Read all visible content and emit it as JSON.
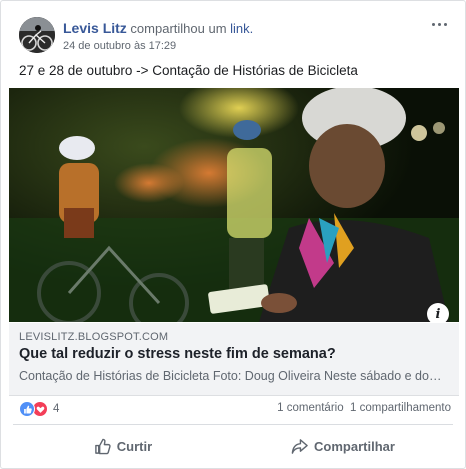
{
  "post": {
    "author": "Levis Litz",
    "shared_text": "compartilhou um",
    "shared_link": "link.",
    "timestamp": "24 de outubro às 17:29",
    "text": "27 e 28 de outubro -> Contação de Histórias de Bicicleta"
  },
  "link_preview": {
    "domain": "LEVISLITZ.BLOGSPOT.COM",
    "title": "Que tal reduzir o stress neste fim de semana?",
    "description": "Contação de Histórias de Bicicleta Foto: Doug Oliveira Neste sábado e domingo..."
  },
  "stats": {
    "reaction_count": "4",
    "comments": "1 comentário",
    "shares": "1 compartilhamento"
  },
  "actions": {
    "like": "Curtir",
    "share": "Compartilhar"
  },
  "icons": {
    "more": "more-options-icon",
    "info": "info-icon",
    "like_reaction": "like-reaction-icon",
    "love_reaction": "love-reaction-icon",
    "like_action": "thumbs-up-icon",
    "share_action": "share-arrow-icon"
  },
  "colors": {
    "link_blue": "#385898",
    "secondary_text": "#606770",
    "like_blue": "#4f8ff7",
    "love_red": "#f33e58"
  }
}
